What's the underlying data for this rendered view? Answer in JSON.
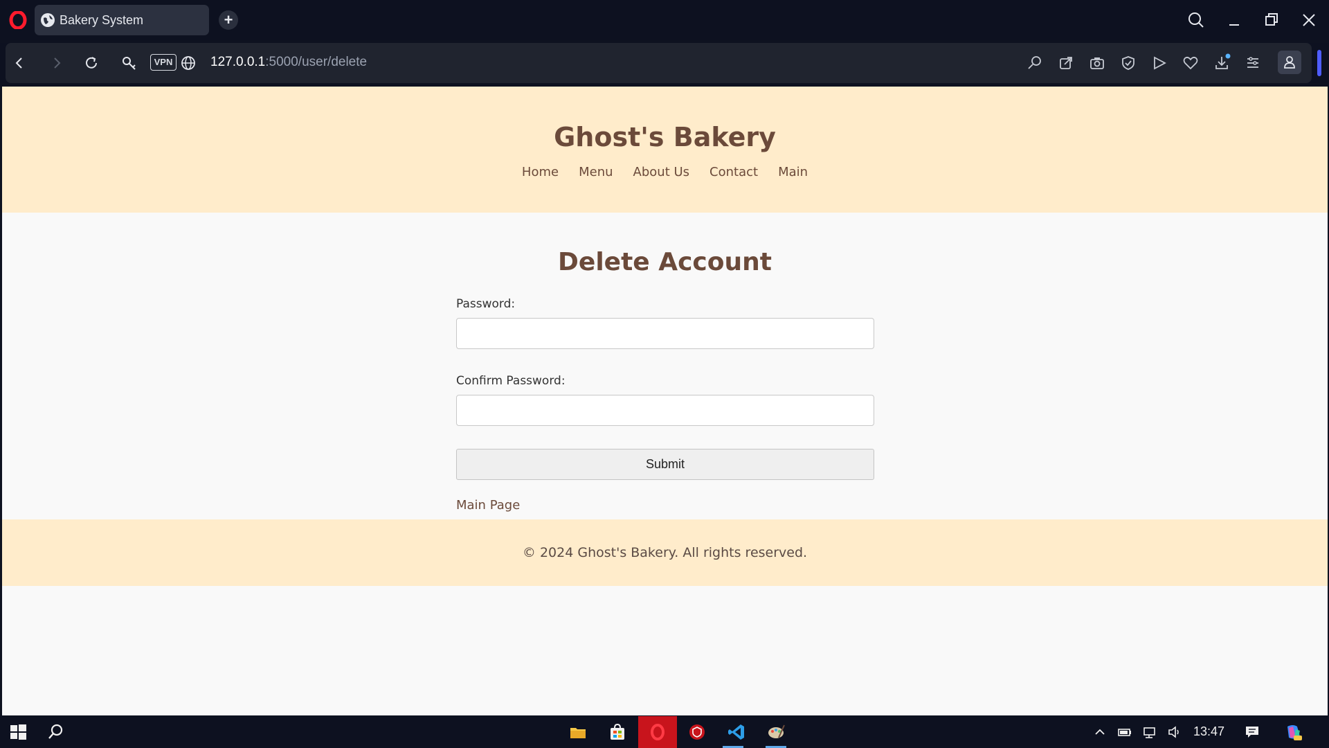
{
  "browser": {
    "tab_title": "Bakery System",
    "url_host": "127.0.0.1",
    "url_path": ":5000/user/delete",
    "vpn_label": "VPN"
  },
  "site": {
    "title": "Ghost's Bakery",
    "nav": [
      "Home",
      "Menu",
      "About Us",
      "Contact",
      "Main"
    ]
  },
  "page": {
    "heading": "Delete Account",
    "password_label": "Password:",
    "confirm_label": "Confirm Password:",
    "password_value": "",
    "confirm_value": "",
    "submit_label": "Submit",
    "main_page_link": "Main Page"
  },
  "footer": {
    "text": "© 2024 Ghost's Bakery. All rights reserved."
  },
  "taskbar": {
    "time": "13:47",
    "apps": [
      "file-explorer-icon",
      "microsoft-store-icon",
      "opera-icon",
      "vpn-shield-icon",
      "vscode-icon",
      "paint-icon"
    ]
  },
  "colors": {
    "brand_brown": "#6b4a3a",
    "header_bg": "#ffeccb",
    "page_bg": "#f9f9f9"
  }
}
